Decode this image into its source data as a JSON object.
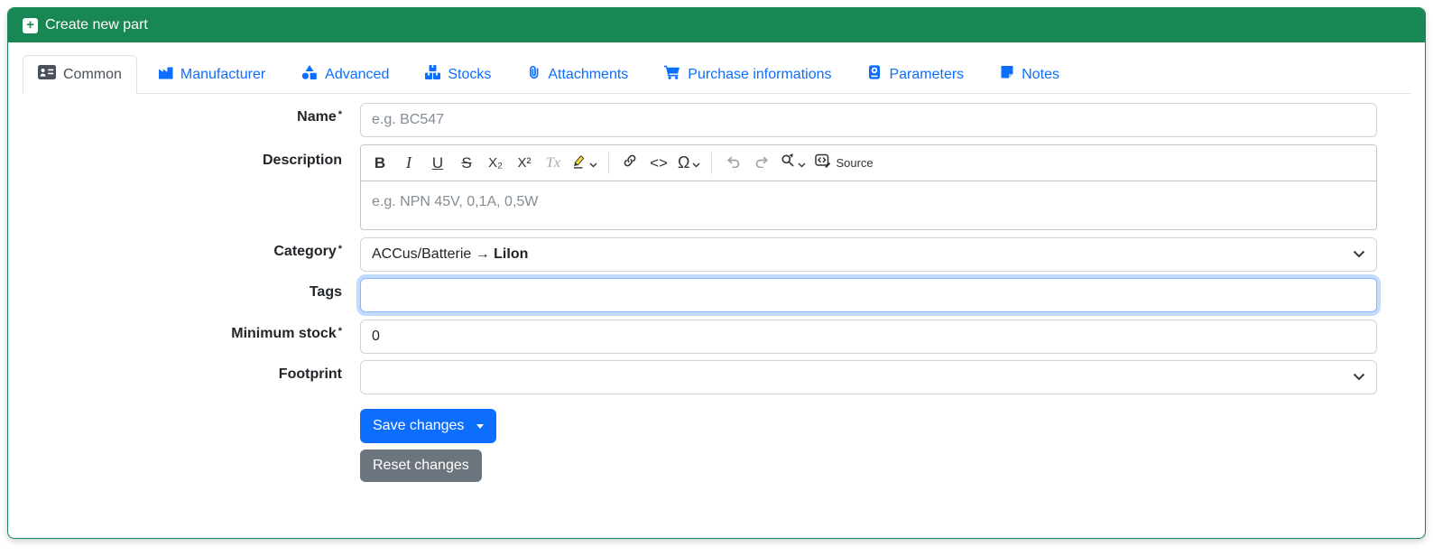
{
  "header": {
    "title": "Create new part"
  },
  "tabs": [
    {
      "label": "Common",
      "icon": "id-card-icon",
      "active": true
    },
    {
      "label": "Manufacturer",
      "icon": "factory-icon",
      "active": false
    },
    {
      "label": "Advanced",
      "icon": "shapes-icon",
      "active": false
    },
    {
      "label": "Stocks",
      "icon": "boxes-stacked-icon",
      "active": false
    },
    {
      "label": "Attachments",
      "icon": "paperclip-icon",
      "active": false
    },
    {
      "label": "Purchase informations",
      "icon": "shopping-cart-icon",
      "active": false
    },
    {
      "label": "Parameters",
      "icon": "parameters-book-icon",
      "active": false
    },
    {
      "label": "Notes",
      "icon": "sticky-note-icon",
      "active": false
    }
  ],
  "form": {
    "name": {
      "label": "Name",
      "required": "*",
      "placeholder": "e.g. BC547",
      "value": ""
    },
    "description": {
      "label": "Description",
      "placeholder": "e.g. NPN 45V, 0,1A, 0,5W",
      "value": ""
    },
    "category": {
      "label": "Category",
      "required": "*",
      "value_prefix": "ACCus/Batterie → ",
      "value_bold": "LiIon"
    },
    "tags": {
      "label": "Tags",
      "value": "",
      "focused": true
    },
    "minimum_stock": {
      "label": "Minimum stock",
      "required": "*",
      "value": "0"
    },
    "footprint": {
      "label": "Footprint",
      "value": ""
    }
  },
  "editor_toolbar": {
    "bold": "B",
    "italic": "I",
    "underline": "U",
    "strikethrough": "S",
    "subscript": "X₂",
    "superscript": "X²",
    "remove_format": "Tx",
    "code": "<>",
    "special_characters": "Ω",
    "source_label": "Source"
  },
  "buttons": {
    "save": "Save changes",
    "reset": "Reset changes"
  },
  "colors": {
    "header_green": "#198754",
    "tab_blue": "#0d6efd",
    "active_tab_text": "#495057",
    "save_button": "#0d6efd",
    "reset_button": "#6c757d",
    "focus_ring": "#86b7fe"
  }
}
